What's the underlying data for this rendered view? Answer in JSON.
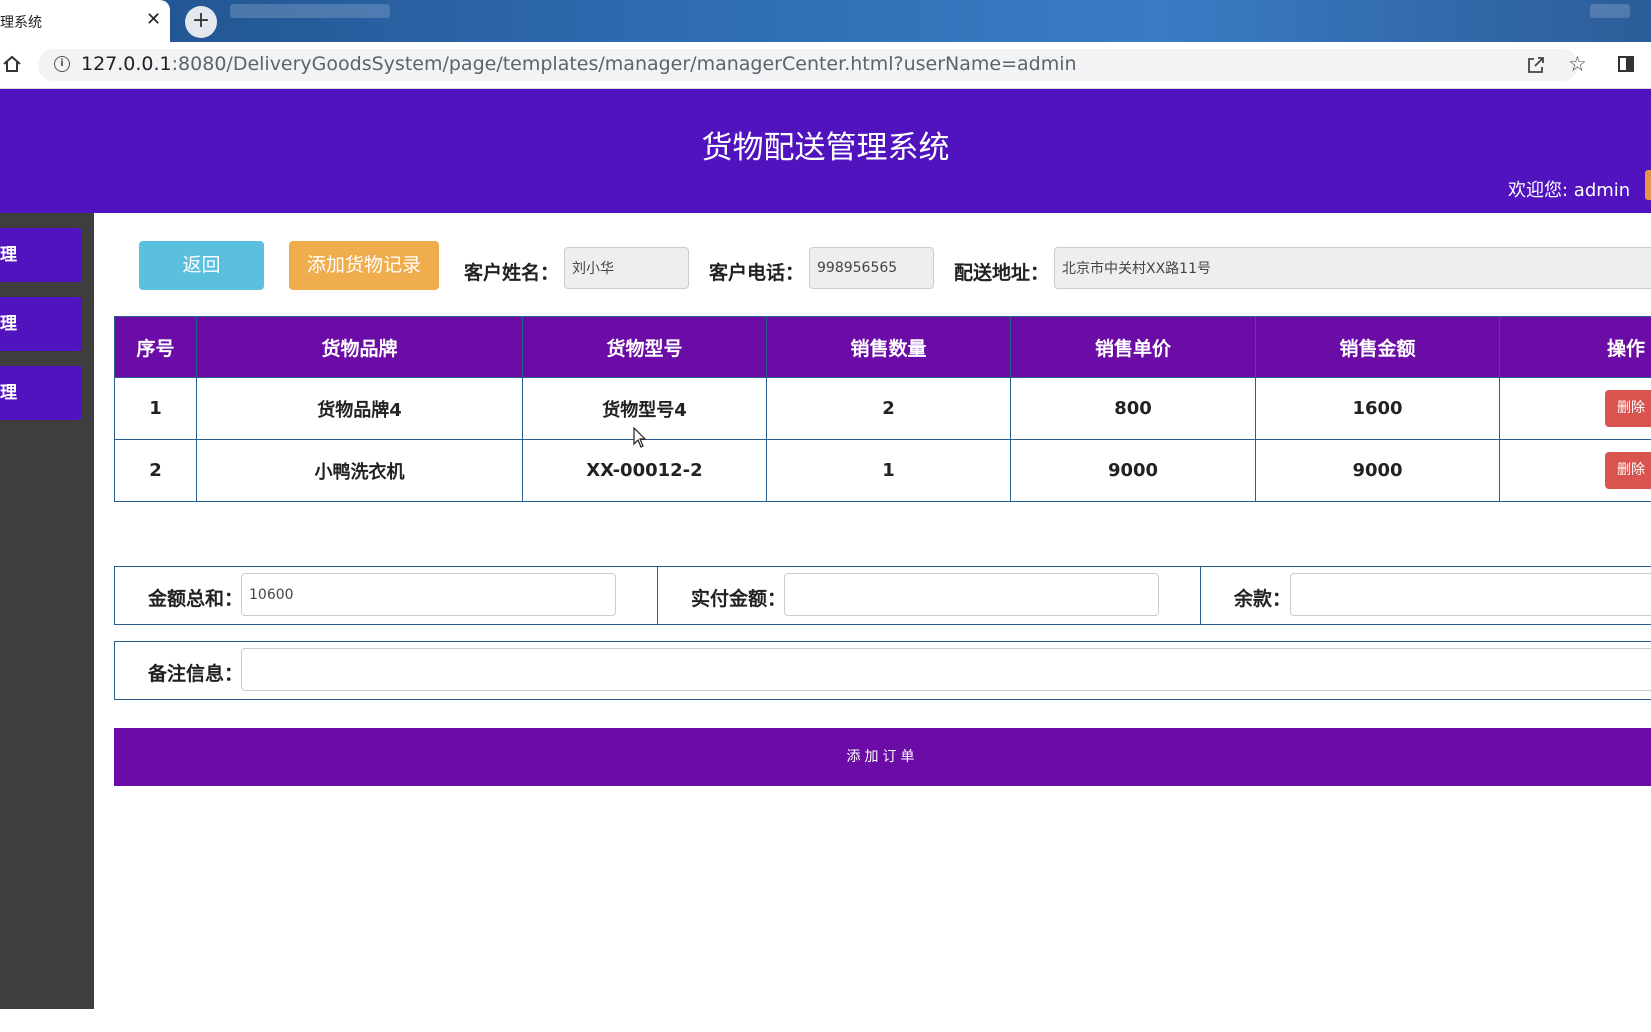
{
  "browser": {
    "tab_title": "理系统",
    "tab_close": "✕",
    "new_tab": "+",
    "url_host": "127.0.0.1",
    "url_rest": ":8080/DeliveryGoodsSystem/page/templates/manager/managerCenter.html?userName=admin"
  },
  "header": {
    "title": "货物配送管理系统",
    "welcome": "欢迎您: admin"
  },
  "sidebar": {
    "items": [
      {
        "label": "理"
      },
      {
        "label": "理"
      },
      {
        "label": "理"
      }
    ]
  },
  "toolbar": {
    "back_label": "返回",
    "add_goods_label": "添加货物记录",
    "customer_name_label": "客户姓名：",
    "customer_name_value": "刘小华",
    "customer_phone_label": "客户电话：",
    "customer_phone_value": "998956565",
    "address_label": "配送地址：",
    "address_value": "北京市中关村XX路11号"
  },
  "table": {
    "headers": [
      "序号",
      "货物品牌",
      "货物型号",
      "销售数量",
      "销售单价",
      "销售金额",
      "操作"
    ],
    "rows": [
      {
        "no": "1",
        "brand": "货物品牌4",
        "model": "货物型号4",
        "qty": "2",
        "price": "800",
        "amount": "1600",
        "action": "删除"
      },
      {
        "no": "2",
        "brand": "小鸭洗衣机",
        "model": "XX-00012-2",
        "qty": "1",
        "price": "9000",
        "amount": "9000",
        "action": "删除"
      }
    ]
  },
  "totals": {
    "sum_label": "金额总和：",
    "sum_value": "10600",
    "paid_label": "实付金额：",
    "paid_value": "",
    "balance_label": "余款：",
    "balance_value": "",
    "remark_label": "备注信息：",
    "remark_value": ""
  },
  "submit_label": "添加订单",
  "colors": {
    "header_bg": "#5013be",
    "table_header_bg": "#6a0ca5",
    "back_btn": "#5bc0de",
    "add_btn": "#f0ad4e",
    "delete_btn": "#d9534f",
    "sidebar_bg": "#3e3e3e"
  }
}
